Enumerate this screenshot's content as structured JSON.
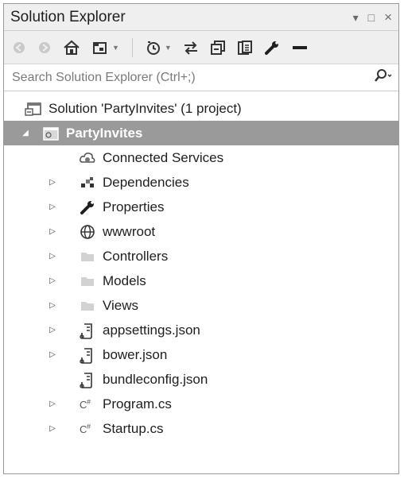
{
  "panel": {
    "title": "Solution Explorer",
    "controls": [
      "▾",
      "□",
      "×"
    ]
  },
  "search": {
    "placeholder": "Search Solution Explorer (Ctrl+;)"
  },
  "tree": {
    "solution": "Solution 'PartyInvites' (1 project)",
    "project": "PartyInvites",
    "items": [
      {
        "label": "Connected Services",
        "icon": "connected-services-icon",
        "expandable": false
      },
      {
        "label": "Dependencies",
        "icon": "dependencies-icon",
        "expandable": true
      },
      {
        "label": "Properties",
        "icon": "wrench-icon",
        "expandable": true
      },
      {
        "label": "wwwroot",
        "icon": "globe-icon",
        "expandable": true
      },
      {
        "label": "Controllers",
        "icon": "folder-icon",
        "expandable": true
      },
      {
        "label": "Models",
        "icon": "folder-icon",
        "expandable": true
      },
      {
        "label": "Views",
        "icon": "folder-icon",
        "expandable": true
      },
      {
        "label": "appsettings.json",
        "icon": "json-file-icon",
        "expandable": true
      },
      {
        "label": "bower.json",
        "icon": "json-file-icon",
        "expandable": true
      },
      {
        "label": "bundleconfig.json",
        "icon": "json-file-icon",
        "expandable": false
      },
      {
        "label": "Program.cs",
        "icon": "csharp-file-icon",
        "expandable": true
      },
      {
        "label": "Startup.cs",
        "icon": "csharp-file-icon",
        "expandable": true
      }
    ]
  },
  "colors": {
    "selected_row": "#9a9a9a",
    "chrome": "#efefef"
  }
}
